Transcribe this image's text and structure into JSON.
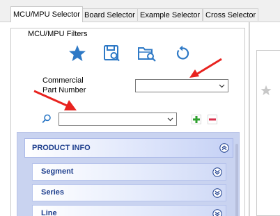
{
  "tabs": [
    {
      "label": "MCU/MPU Selector",
      "active": true
    },
    {
      "label": "Board Selector",
      "active": false
    },
    {
      "label": "Example Selector",
      "active": false
    },
    {
      "label": "Cross Selector",
      "active": false
    }
  ],
  "filters": {
    "group_title": "MCU/MPU Filters",
    "toolbar": [
      {
        "icon": "star-icon"
      },
      {
        "icon": "save-search-icon"
      },
      {
        "icon": "open-folder-search-icon"
      },
      {
        "icon": "reset-icon"
      }
    ],
    "commercial_part_number": {
      "label_line1": "Commercial",
      "label_line2": "Part Number",
      "value": ""
    },
    "search": {
      "value": ""
    }
  },
  "product_info": {
    "header": "PRODUCT INFO",
    "items": [
      {
        "label": "Segment"
      },
      {
        "label": "Series"
      },
      {
        "label": "Line"
      }
    ]
  },
  "colors": {
    "accent_blue": "#2e79c6",
    "header_text": "#1d3e8d",
    "annotation_red": "#e8231f",
    "plus_green": "#2fa12f",
    "minus_red": "#d9304c"
  }
}
